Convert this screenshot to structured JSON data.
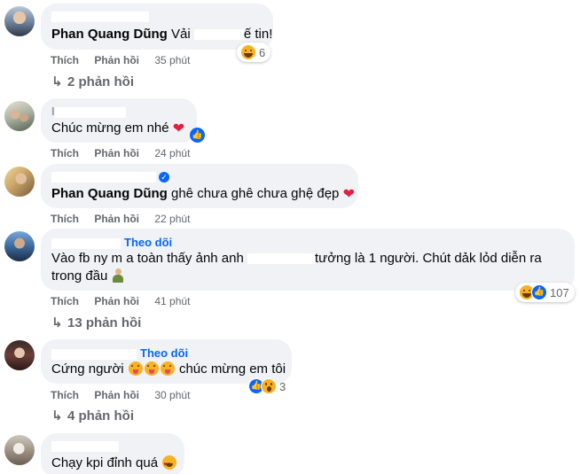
{
  "actions": {
    "like": "Thích",
    "reply": "Phản hồi"
  },
  "comments": [
    {
      "author": "Phan Quang Dũng",
      "text_a": " Vải ",
      "text_b": "ế tin!",
      "time": "35 phút",
      "reaction_count": "6",
      "replies": "2 phản hồi"
    },
    {
      "author_initial": "I",
      "text": "Chúc mừng em nhé",
      "time": "24 phút"
    },
    {
      "author": "Phan Quang Dũng",
      "text": " ghê chưa ghê chưa ghệ đẹp",
      "time": "22 phút"
    },
    {
      "follow": "Theo dõi",
      "text_line1a": "Vào fb ny m a toàn thấy ảnh anh ",
      "text_line1b": "tưởng là 1 người. Chút dảk lỏd diễn ra",
      "text_line2": "trong đầu",
      "time": "41 phút",
      "reaction_count": "107",
      "replies": "13 phản hồi"
    },
    {
      "follow": "Theo dõi",
      "text_a": "Cứng người",
      "text_b": " chúc mừng em tôi",
      "time": "30 phút",
      "reaction_count": "3",
      "replies": "4 phản hồi"
    },
    {
      "text": "Chạy kpi đỉnh quá"
    }
  ],
  "colors": {
    "bubble": "#f0f2f5",
    "link": "#0866ff",
    "muted": "#65676b",
    "heart": "#e41e3f"
  }
}
